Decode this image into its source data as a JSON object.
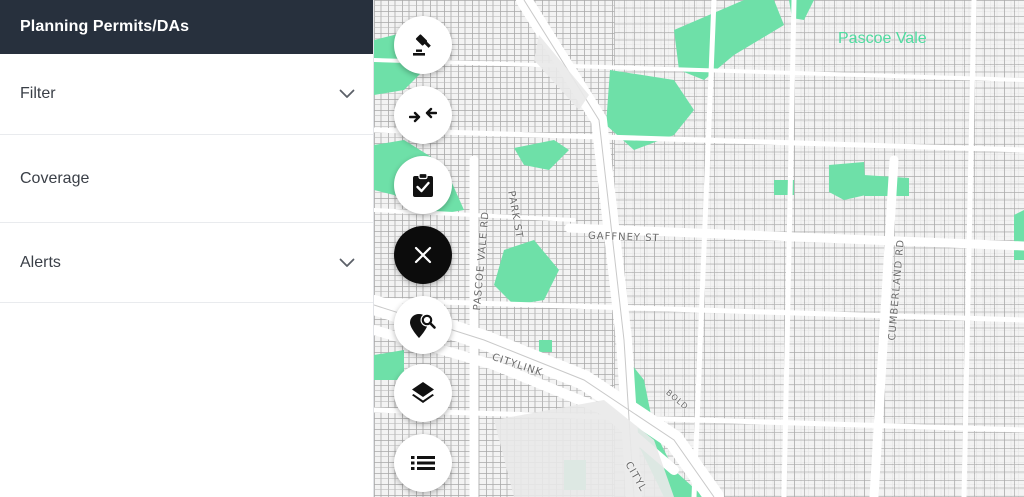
{
  "sidebar": {
    "title": "Planning Permits/DAs",
    "items": [
      {
        "label": "Filter",
        "expandable": true
      },
      {
        "label": "Coverage",
        "expandable": false
      },
      {
        "label": "Alerts",
        "expandable": true
      }
    ]
  },
  "map": {
    "suburb": "Pascoe Vale",
    "streets": {
      "gaffney": "GAFFNEY ST",
      "park": "PARK ST",
      "pascoe_vale_rd": "PASCOE VALE RD",
      "cumberland": "CUMBERLAND RD",
      "citylink": "CITYLINK",
      "citylink_lower": "CITYL",
      "small": "BOLD"
    }
  },
  "toolbar": {
    "buttons": [
      {
        "icon": "gavel-icon"
      },
      {
        "icon": "compress-arrows-icon"
      },
      {
        "icon": "clipboard-check-icon"
      },
      {
        "icon": "close-icon"
      },
      {
        "icon": "location-search-icon"
      },
      {
        "icon": "layers-icon"
      },
      {
        "icon": "list-icon"
      }
    ]
  },
  "colors": {
    "header": "#27303d",
    "park_green": "#6ee0a8",
    "suburb_label": "#4fdca0",
    "close_fab": "#0c0c0c"
  }
}
